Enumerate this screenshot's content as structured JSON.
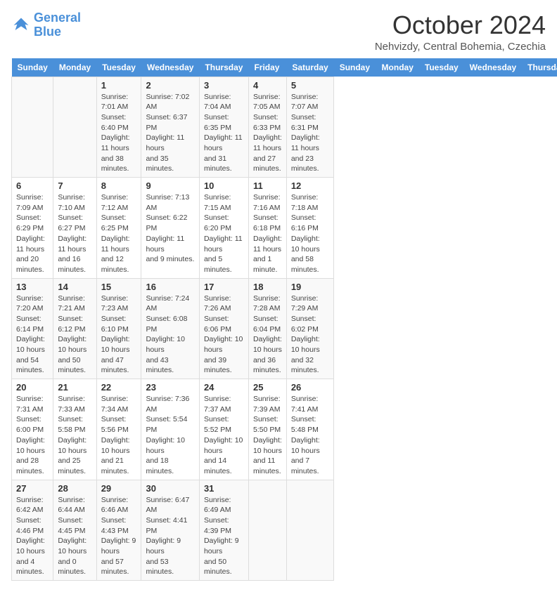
{
  "logo": {
    "line1": "General",
    "line2": "Blue"
  },
  "title": "October 2024",
  "location": "Nehvizdy, Central Bohemia, Czechia",
  "header_days": [
    "Sunday",
    "Monday",
    "Tuesday",
    "Wednesday",
    "Thursday",
    "Friday",
    "Saturday"
  ],
  "weeks": [
    [
      {
        "day": "",
        "info": ""
      },
      {
        "day": "",
        "info": ""
      },
      {
        "day": "1",
        "info": "Sunrise: 7:01 AM\nSunset: 6:40 PM\nDaylight: 11 hours\nand 38 minutes."
      },
      {
        "day": "2",
        "info": "Sunrise: 7:02 AM\nSunset: 6:37 PM\nDaylight: 11 hours\nand 35 minutes."
      },
      {
        "day": "3",
        "info": "Sunrise: 7:04 AM\nSunset: 6:35 PM\nDaylight: 11 hours\nand 31 minutes."
      },
      {
        "day": "4",
        "info": "Sunrise: 7:05 AM\nSunset: 6:33 PM\nDaylight: 11 hours\nand 27 minutes."
      },
      {
        "day": "5",
        "info": "Sunrise: 7:07 AM\nSunset: 6:31 PM\nDaylight: 11 hours\nand 23 minutes."
      }
    ],
    [
      {
        "day": "6",
        "info": "Sunrise: 7:09 AM\nSunset: 6:29 PM\nDaylight: 11 hours\nand 20 minutes."
      },
      {
        "day": "7",
        "info": "Sunrise: 7:10 AM\nSunset: 6:27 PM\nDaylight: 11 hours\nand 16 minutes."
      },
      {
        "day": "8",
        "info": "Sunrise: 7:12 AM\nSunset: 6:25 PM\nDaylight: 11 hours\nand 12 minutes."
      },
      {
        "day": "9",
        "info": "Sunrise: 7:13 AM\nSunset: 6:22 PM\nDaylight: 11 hours\nand 9 minutes."
      },
      {
        "day": "10",
        "info": "Sunrise: 7:15 AM\nSunset: 6:20 PM\nDaylight: 11 hours\nand 5 minutes."
      },
      {
        "day": "11",
        "info": "Sunrise: 7:16 AM\nSunset: 6:18 PM\nDaylight: 11 hours\nand 1 minute."
      },
      {
        "day": "12",
        "info": "Sunrise: 7:18 AM\nSunset: 6:16 PM\nDaylight: 10 hours\nand 58 minutes."
      }
    ],
    [
      {
        "day": "13",
        "info": "Sunrise: 7:20 AM\nSunset: 6:14 PM\nDaylight: 10 hours\nand 54 minutes."
      },
      {
        "day": "14",
        "info": "Sunrise: 7:21 AM\nSunset: 6:12 PM\nDaylight: 10 hours\nand 50 minutes."
      },
      {
        "day": "15",
        "info": "Sunrise: 7:23 AM\nSunset: 6:10 PM\nDaylight: 10 hours\nand 47 minutes."
      },
      {
        "day": "16",
        "info": "Sunrise: 7:24 AM\nSunset: 6:08 PM\nDaylight: 10 hours\nand 43 minutes."
      },
      {
        "day": "17",
        "info": "Sunrise: 7:26 AM\nSunset: 6:06 PM\nDaylight: 10 hours\nand 39 minutes."
      },
      {
        "day": "18",
        "info": "Sunrise: 7:28 AM\nSunset: 6:04 PM\nDaylight: 10 hours\nand 36 minutes."
      },
      {
        "day": "19",
        "info": "Sunrise: 7:29 AM\nSunset: 6:02 PM\nDaylight: 10 hours\nand 32 minutes."
      }
    ],
    [
      {
        "day": "20",
        "info": "Sunrise: 7:31 AM\nSunset: 6:00 PM\nDaylight: 10 hours\nand 28 minutes."
      },
      {
        "day": "21",
        "info": "Sunrise: 7:33 AM\nSunset: 5:58 PM\nDaylight: 10 hours\nand 25 minutes."
      },
      {
        "day": "22",
        "info": "Sunrise: 7:34 AM\nSunset: 5:56 PM\nDaylight: 10 hours\nand 21 minutes."
      },
      {
        "day": "23",
        "info": "Sunrise: 7:36 AM\nSunset: 5:54 PM\nDaylight: 10 hours\nand 18 minutes."
      },
      {
        "day": "24",
        "info": "Sunrise: 7:37 AM\nSunset: 5:52 PM\nDaylight: 10 hours\nand 14 minutes."
      },
      {
        "day": "25",
        "info": "Sunrise: 7:39 AM\nSunset: 5:50 PM\nDaylight: 10 hours\nand 11 minutes."
      },
      {
        "day": "26",
        "info": "Sunrise: 7:41 AM\nSunset: 5:48 PM\nDaylight: 10 hours\nand 7 minutes."
      }
    ],
    [
      {
        "day": "27",
        "info": "Sunrise: 6:42 AM\nSunset: 4:46 PM\nDaylight: 10 hours\nand 4 minutes."
      },
      {
        "day": "28",
        "info": "Sunrise: 6:44 AM\nSunset: 4:45 PM\nDaylight: 10 hours\nand 0 minutes."
      },
      {
        "day": "29",
        "info": "Sunrise: 6:46 AM\nSunset: 4:43 PM\nDaylight: 9 hours\nand 57 minutes."
      },
      {
        "day": "30",
        "info": "Sunrise: 6:47 AM\nSunset: 4:41 PM\nDaylight: 9 hours\nand 53 minutes."
      },
      {
        "day": "31",
        "info": "Sunrise: 6:49 AM\nSunset: 4:39 PM\nDaylight: 9 hours\nand 50 minutes."
      },
      {
        "day": "",
        "info": ""
      },
      {
        "day": "",
        "info": ""
      }
    ]
  ]
}
